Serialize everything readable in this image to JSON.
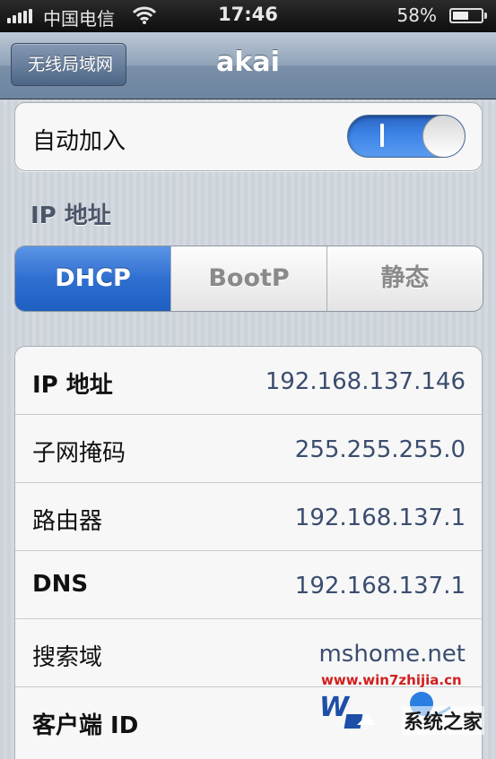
{
  "status_bar": {
    "carrier": "中国电信",
    "time": "17:46",
    "battery_percent": "58%",
    "battery_level": 0.58,
    "signal_icon": "signal-bars-icon",
    "wifi_icon": "wifi-icon",
    "battery_icon": "battery-icon"
  },
  "nav": {
    "back_label": "无线局域网",
    "title": "akai"
  },
  "auto_join": {
    "label": "自动加入",
    "toggle_on_glyph": "I",
    "state": "on"
  },
  "ip_section": {
    "header": "IP 地址",
    "segments": [
      "DHCP",
      "BootP",
      "静态"
    ],
    "selected_segment": "DHCP"
  },
  "details": [
    {
      "label": "IP 地址",
      "value": "192.168.137.146"
    },
    {
      "label": "子网掩码",
      "value": "255.255.255.0"
    },
    {
      "label": "路由器",
      "value": "192.168.137.1"
    },
    {
      "label": "DNS",
      "value": "192.168.137.1"
    },
    {
      "label": "搜索域",
      "value": "mshome.net"
    },
    {
      "label": "客户端 ID",
      "value": ""
    }
  ],
  "watermark": {
    "url": "www.win7zhijia.cn",
    "brand": "系统之家"
  },
  "colors": {
    "accent_blue": "#2f6fd0",
    "value_text": "#3b4d6e",
    "watermark_red": "#d21e1e"
  }
}
